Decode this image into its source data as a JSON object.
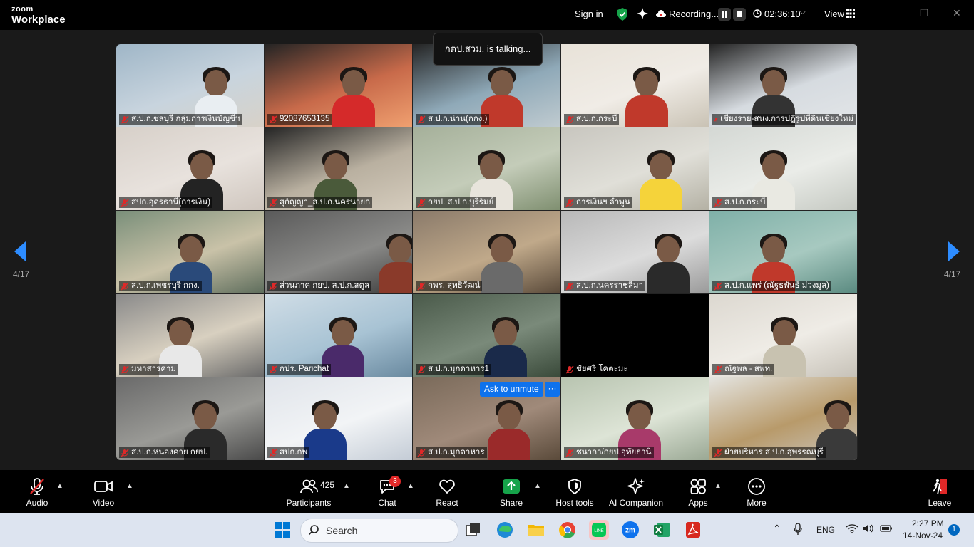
{
  "app": {
    "brand_top": "zoom",
    "brand_bottom": "Workplace"
  },
  "topbar": {
    "sign_in": "Sign in",
    "recording_label": "Recording...",
    "elapsed": "02:36:10",
    "view_label": "View"
  },
  "speaker_banner": "กตป.สวม. is talking...",
  "pagination": {
    "left": "4/17",
    "right": "4/17"
  },
  "ask_to_unmute": "Ask to unmute",
  "more_dots": "···",
  "tiles": [
    {
      "name": "ส.ป.ก.ชลบุรี กลุ่มการเงินบัญชีฯ"
    },
    {
      "name": "92087653135"
    },
    {
      "name": "ส.ป.ก.น่าน(กกง.)"
    },
    {
      "name": "ส.ป.ก.กระบี่"
    },
    {
      "name": "เชียงราย-สนง.การปฏิรูปที่ดินเชียงใหม่"
    },
    {
      "name": "สปก.อุดรธานี(การเงิน)"
    },
    {
      "name": "สุกัญญา_ส.ป.ก.นครนายก"
    },
    {
      "name": "กยป. ส.ป.ก.บุรีรัมย์"
    },
    {
      "name": "การเงินฯ ลำพูน"
    },
    {
      "name": "ส.ป.ก.กระบี่"
    },
    {
      "name": "ส.ป.ก.เพชรบุรี กกง."
    },
    {
      "name": "ส่วนภาค กยป. ส.ป.ก.สตูล"
    },
    {
      "name": "กพร. สุทธิวัฒน์"
    },
    {
      "name": "ส.ป.ก.นครราชสีมา"
    },
    {
      "name": "ส.ป.ก.แพร่ (ณัฐธพันธ์ ม่วงมูล)"
    },
    {
      "name": "มหาสารคาม"
    },
    {
      "name": "กปร. Parichat"
    },
    {
      "name": "ส.ป.ก.มุกดาหาร1"
    },
    {
      "name": "ชัยศรี โคตะมะ"
    },
    {
      "name": "ณัฐพล - สพท."
    },
    {
      "name": "ส.ป.ก.หนองคาย กยป."
    },
    {
      "name": "สปก.กพ"
    },
    {
      "name": "ส.ป.ก.มุกดาหาร"
    },
    {
      "name": "ชนากา/กยป.อุทัยธานี"
    },
    {
      "name": "ฝ่ายบริหาร ส.ป.ก.สุพรรณบุรี"
    }
  ],
  "toolbar": {
    "audio": "Audio",
    "video": "Video",
    "participants": "Participants",
    "participants_count": "425",
    "chat": "Chat",
    "chat_badge": "3",
    "react": "React",
    "share": "Share",
    "host_tools": "Host tools",
    "ai_companion": "AI Companion",
    "apps": "Apps",
    "more": "More",
    "leave": "Leave"
  },
  "taskbar": {
    "search_placeholder": "Search",
    "language": "ENG",
    "time": "2:27 PM",
    "date": "14-Nov-24",
    "notifications": "1"
  },
  "colors": {
    "zoom_blue": "#0e72ed",
    "record_red": "#e02828",
    "active_green": "#16a34a"
  }
}
